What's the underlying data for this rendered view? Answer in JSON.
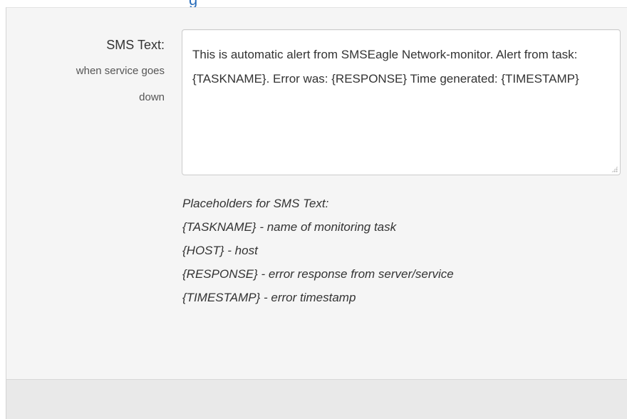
{
  "heading_fragment": "g",
  "sms_field": {
    "label": "SMS Text:",
    "sublabel_lines": [
      "when service goes",
      "down"
    ],
    "value": "This is automatic alert from SMSEagle Network-monitor. Alert from task: {TASKNAME}. Error was: {RESPONSE} Time generated: {TIMESTAMP}"
  },
  "placeholders_help": {
    "title": "Placeholders for SMS Text:",
    "items": [
      "{TASKNAME} - name of monitoring task",
      "{HOST} - host",
      "{RESPONSE} - error response from server/service",
      "{TIMESTAMP} - error timestamp"
    ]
  }
}
